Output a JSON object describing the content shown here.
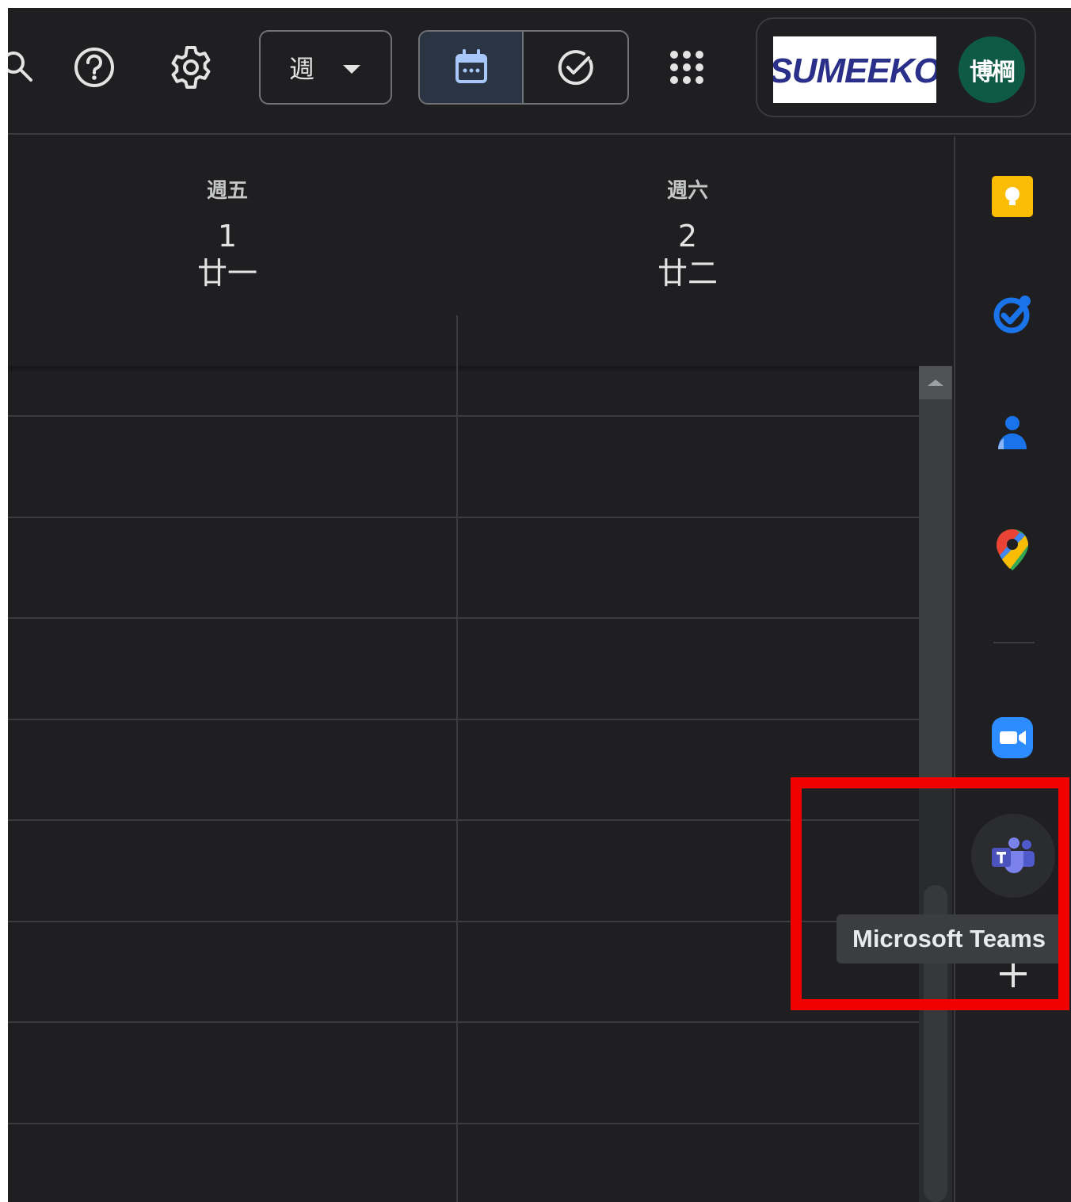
{
  "toolbar": {
    "view_select_label": "週",
    "logo_text": "SUMEEKO",
    "avatar_text": "博棡"
  },
  "days": [
    {
      "dow": "週五",
      "date": "1",
      "lunar": "廿一"
    },
    {
      "dow": "週六",
      "date": "2",
      "lunar": "廿二"
    }
  ],
  "side_panel": {
    "apps": [
      "Keep",
      "Tasks",
      "Contacts",
      "Maps",
      "Zoom",
      "Microsoft Teams"
    ],
    "tooltip": "Microsoft Teams"
  },
  "colors": {
    "background": "#1f1f21",
    "gridline": "#3a3b3d",
    "active_view_bg": "#2b3442",
    "avatar_bg": "#0e5a45",
    "highlight": "#f00000"
  }
}
